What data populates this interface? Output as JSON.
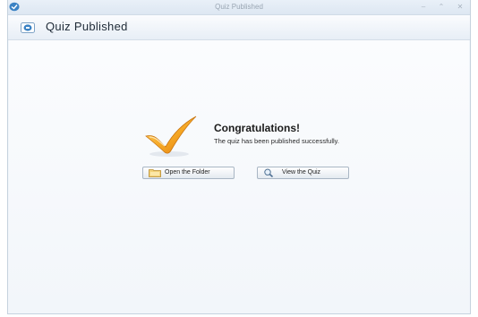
{
  "window": {
    "title": "Quiz Published",
    "minimize_label": "–",
    "maximize_label": "⌃",
    "close_label": "✕"
  },
  "header": {
    "title": "Quiz  Published"
  },
  "message": {
    "heading": "Congratulations!",
    "body": "The quiz has been published successfully."
  },
  "buttons": {
    "open_folder": "Open the Folder",
    "view_quiz": "View the Quiz"
  },
  "icons": {
    "app": "app-logo-icon",
    "header": "quiz-published-icon",
    "success": "checkmark-icon",
    "folder": "folder-icon",
    "view": "magnifier-icon"
  },
  "colors": {
    "accent": "#3b82c4",
    "check": "#f5a623",
    "window_bg": "#f2f6fb"
  }
}
